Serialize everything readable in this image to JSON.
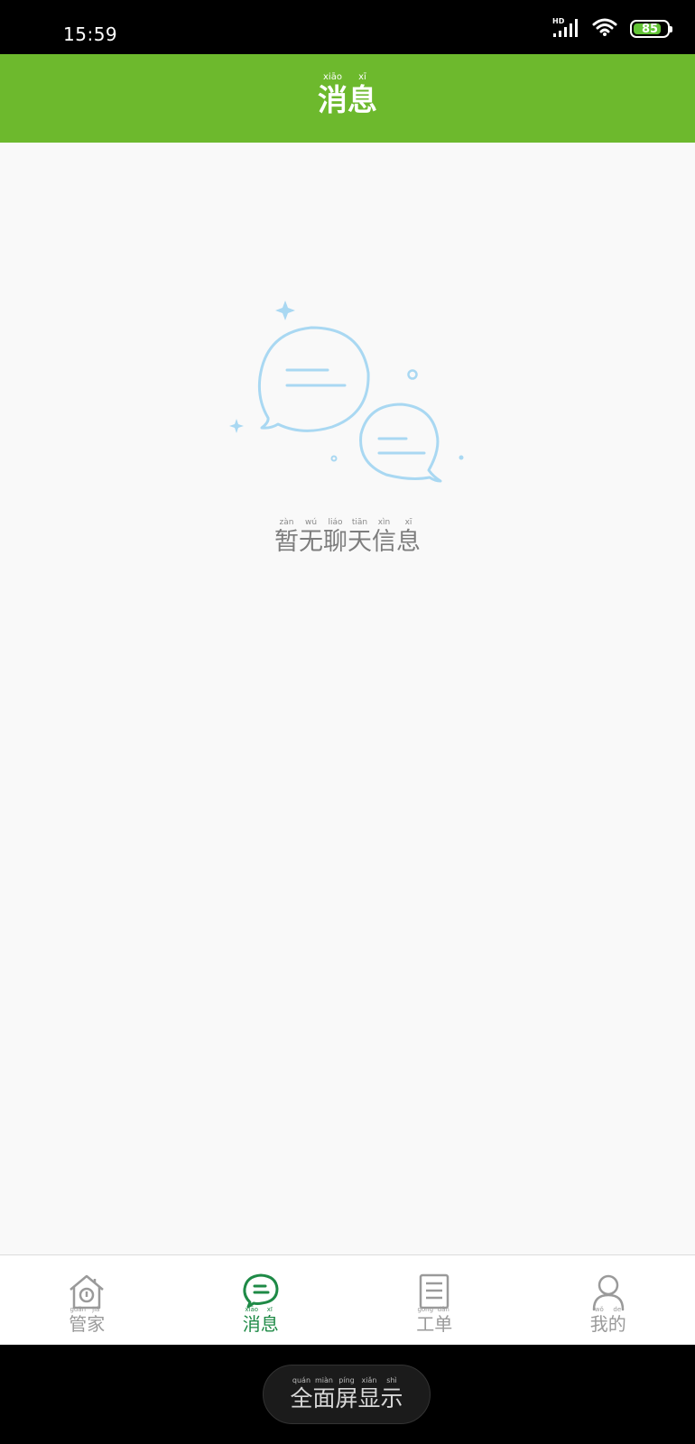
{
  "status_bar": {
    "time": "15:59",
    "battery": "85",
    "network_label": "HD"
  },
  "header": {
    "title": [
      {
        "char": "消",
        "pinyin": "xiāo"
      },
      {
        "char": "息",
        "pinyin": "xī"
      }
    ]
  },
  "empty_state": {
    "message": [
      {
        "char": "暂",
        "pinyin": "zàn"
      },
      {
        "char": "无",
        "pinyin": "wú"
      },
      {
        "char": "聊",
        "pinyin": "liáo"
      },
      {
        "char": "天",
        "pinyin": "tiān"
      },
      {
        "char": "信",
        "pinyin": "xìn"
      },
      {
        "char": "息",
        "pinyin": "xī"
      }
    ],
    "icon": "chat-bubbles-icon"
  },
  "tabs": [
    {
      "id": "guanjia",
      "icon": "house-icon",
      "active": false,
      "label": [
        {
          "char": "管",
          "pinyin": "guǎn"
        },
        {
          "char": "家",
          "pinyin": "jiā"
        }
      ]
    },
    {
      "id": "xiaoxi",
      "icon": "chat-bubble-icon",
      "active": true,
      "label": [
        {
          "char": "消",
          "pinyin": "xiāo"
        },
        {
          "char": "息",
          "pinyin": "xī"
        }
      ]
    },
    {
      "id": "gongdan",
      "icon": "document-icon",
      "active": false,
      "label": [
        {
          "char": "工",
          "pinyin": "gōng"
        },
        {
          "char": "单",
          "pinyin": "dān"
        }
      ]
    },
    {
      "id": "wode",
      "icon": "person-icon",
      "active": false,
      "label": [
        {
          "char": "我",
          "pinyin": "wǒ"
        },
        {
          "char": "的",
          "pinyin": "de"
        }
      ]
    }
  ],
  "system_nav": {
    "fullscreen_label": [
      {
        "char": "全",
        "pinyin": "quán"
      },
      {
        "char": "面",
        "pinyin": "miàn"
      },
      {
        "char": "屏",
        "pinyin": "píng"
      },
      {
        "char": "显",
        "pinyin": "xiǎn"
      },
      {
        "char": "示",
        "pinyin": "shì"
      }
    ]
  },
  "colors": {
    "accent": "#6db92d",
    "active_tab": "#1e8a46",
    "inactive_tab": "#9a9a9a",
    "illustration": "#a9d8f2"
  }
}
